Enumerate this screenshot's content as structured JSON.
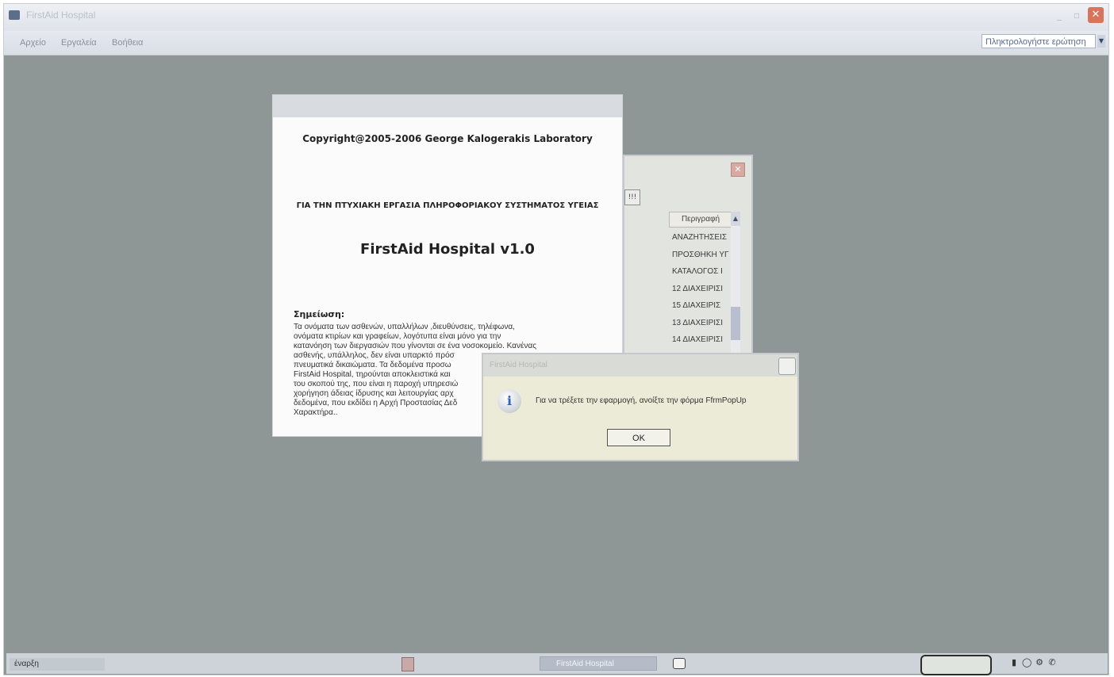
{
  "window": {
    "title": "FirstAid Hospital",
    "minimize_glyph": "_",
    "restore_glyph": "▫",
    "close_glyph": "✕"
  },
  "menu": {
    "items": [
      "Αρχείο",
      "Εργαλεία",
      "Βοήθεια"
    ],
    "help_placeholder": "Πληκτρολογήστε ερώτηση",
    "help_dropdown_glyph": "▼"
  },
  "list_window": {
    "toolbar_glyph": "!!!",
    "column_header": "Περιγραφή",
    "scroll_up_glyph": "▲",
    "close_glyph": "✕",
    "rows": [
      "ΑΝΑΖΗΤΗΣΕΙΣ",
      "ΠΡΟΣΘΗΚΗ ΥΓ",
      "ΚΑΤΑΛΟΓΟΣ Ι",
      "12 ΔΙΑΧΕΙΡΙΣΙ",
      "15 ΔΙΑΧΕΙΡΙΣ",
      "13 ΔΙΑΧΕΙΡΙΣΙ",
      "14 ΔΙΑΧΕΙΡΙΣΙ"
    ]
  },
  "splash": {
    "copyright": "Copyright@2005-2006 George Kalogerakis Laboratory",
    "thesis": "ΓΙΑ ΤΗΝ ΠΤΥΧΙΑΚΗ ΕΡΓΑΣΙΑ ΠΛΗΡΟΦΟΡΙΑΚΟΥ ΣΥΣΤΗΜΑΤΟΣ ΥΓΕΙΑΣ",
    "app_name": "FirstAid Hospital v1.0",
    "note_label": "Σημείωση:",
    "note_lines": [
      "Τα ονόματα των ασθενών, υπαλλήλων ,διευθύνσεις, τηλέφωνα,",
      "ονόματα κτιρίων και γραφείων, λογότυπα είναι μόνο για την",
      "κατανόηση των διεργασιών που γίνονται σε ένα νοσοκομείο. Κανένας",
      "ασθενής, υπάλληλος, δεν είναι υπαρκτό πρόσ",
      "πνευματικά δικαιώματα. Τα δεδομένα προσω",
      "FirstAid Hospital, τηρούνται αποκλειστικά και",
      "του σκοπού της, που είναι η παροχή υπηρεσιώ",
      "χορήγηση άδειας ίδρυσης και λειτουργίας αρχ",
      "δεδομένα, που εκδίδει η Αρχή Προστασίας Δεδ",
      "Χαρακτήρα.."
    ]
  },
  "message_box": {
    "title": "FirstAid Hospital",
    "icon": "i",
    "text": "Για να τρέξετε την εφαρμογή, ανοίξτε την φόρμα FfrmPopUp",
    "ok_label": "OK"
  },
  "taskbar": {
    "start_label": "έναρξη",
    "task_label": "FirstAid Hospital",
    "tray_icons": [
      "▮",
      "◯",
      "⚙",
      "✆"
    ]
  }
}
